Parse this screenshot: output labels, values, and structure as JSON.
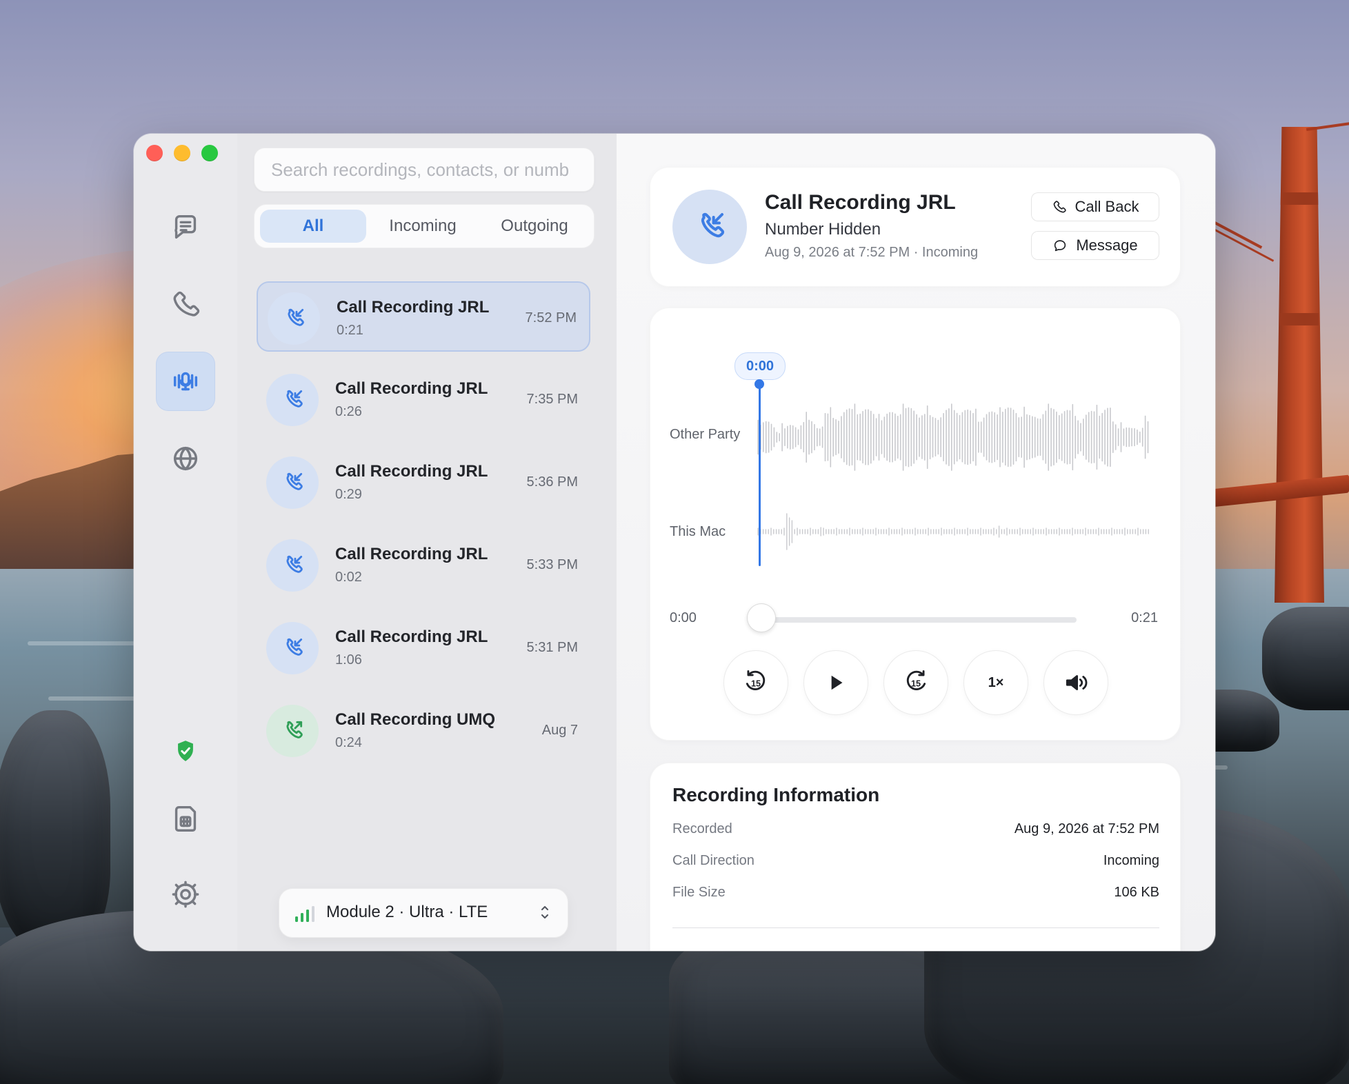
{
  "search": {
    "placeholder": "Search recordings, contacts, or numb"
  },
  "filters": {
    "all": "All",
    "incoming": "Incoming",
    "outgoing": "Outgoing"
  },
  "recordings": [
    {
      "title": "Call Recording JRL",
      "duration": "0:21",
      "time": "7:52 PM",
      "direction": "incoming",
      "selected": true
    },
    {
      "title": "Call Recording JRL",
      "duration": "0:26",
      "time": "7:35 PM",
      "direction": "incoming",
      "selected": false
    },
    {
      "title": "Call Recording JRL",
      "duration": "0:29",
      "time": "5:36 PM",
      "direction": "incoming",
      "selected": false
    },
    {
      "title": "Call Recording JRL",
      "duration": "0:02",
      "time": "5:33 PM",
      "direction": "incoming",
      "selected": false
    },
    {
      "title": "Call Recording JRL",
      "duration": "1:06",
      "time": "5:31 PM",
      "direction": "incoming",
      "selected": false
    },
    {
      "title": "Call Recording UMQ",
      "duration": "0:24",
      "time": "Aug 7",
      "direction": "outgoing",
      "selected": false
    }
  ],
  "module_selector": {
    "label": "Module 2 · Ultra · LTE"
  },
  "detail": {
    "title": "Call Recording JRL",
    "subtitle": "Number Hidden",
    "meta": "Aug 9, 2026 at 7:52 PM · Incoming",
    "call_back": "Call Back",
    "message": "Message"
  },
  "player": {
    "other_party_label": "Other Party",
    "this_mac_label": "This Mac",
    "current_time": "0:00",
    "start_time": "0:00",
    "end_time": "0:21",
    "progress": 0,
    "speed": "1×"
  },
  "recording_info": {
    "title": "Recording Information",
    "rows": [
      {
        "label": "Recorded",
        "value": "Aug 9, 2026 at 7:52 PM"
      },
      {
        "label": "Call Direction",
        "value": "Incoming"
      },
      {
        "label": "File Size",
        "value": "106 KB"
      }
    ]
  },
  "colors": {
    "accent": "#3478e6",
    "incoming_bg": "#d6e1f4",
    "incoming_icon": "#3d7de4",
    "outgoing_bg": "#d8ebdf",
    "outgoing_icon": "#2f9f57",
    "shield": "#30b052"
  },
  "icons": {
    "messages": "messages-icon",
    "phone": "phone-icon",
    "recordings": "recordings-icon",
    "globe": "globe-icon",
    "shield": "shield-icon",
    "sim": "sim-card-icon",
    "settings": "gear-icon"
  }
}
